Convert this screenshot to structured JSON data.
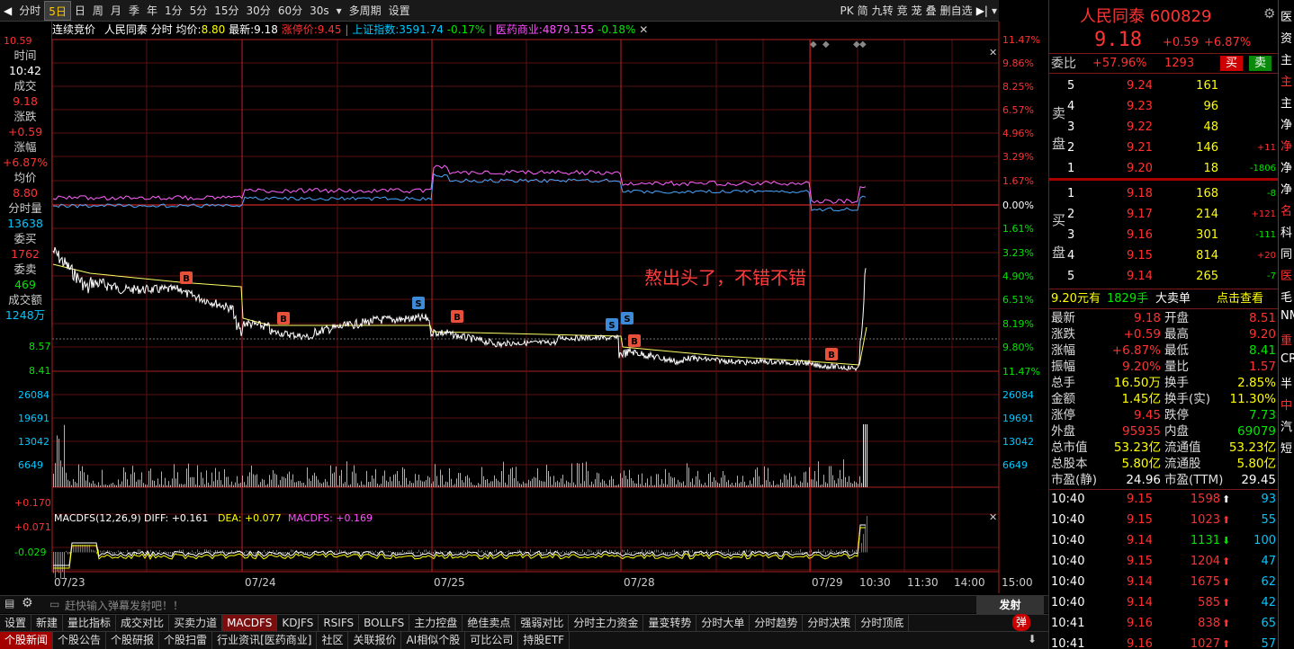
{
  "toolbar": {
    "items": [
      "分时",
      "5日",
      "日",
      "周",
      "月",
      "季",
      "年",
      "1分",
      "5分",
      "15分",
      "30分",
      "60分",
      "30s",
      "多周期",
      "设置"
    ],
    "active": 1,
    "right_items": [
      "PK",
      "简",
      "九转",
      "竞",
      "茏",
      "叠",
      "删自选"
    ]
  },
  "chart": {
    "source": "连续竞价",
    "stock_name": "人民同泰",
    "mode": "分时",
    "avg_label": "均价:",
    "avg_val": "8.80",
    "last_label": "最新:",
    "last_val": "9.18",
    "limit_label": "涨停价:",
    "limit_val": "9.45",
    "idx1": "上证指数:",
    "idx1_val": "3591.74",
    "idx1_chg": "-0.17%",
    "idx2": "医药商业:",
    "idx2_val": "4879.155",
    "idx2_chg": "-0.18%"
  },
  "price_axis": {
    "left_top": "10.59",
    "left_mid": "8.57",
    "left_bot": "8.41"
  },
  "pct_axis": {
    "upper": [
      "11.47%",
      "9.86%",
      "8.25%",
      "6.57%",
      "4.96%",
      "3.29%",
      "1.67%",
      "0.00%"
    ],
    "lower": [
      "1.61%",
      "3.23%",
      "4.90%",
      "6.51%",
      "8.19%",
      "9.80%",
      "11.47%"
    ]
  },
  "vol_axis": [
    "26084",
    "19691",
    "13042",
    "6649"
  ],
  "macd": {
    "title": "MACDFS(12,26,9)",
    "diff": "DIFF: +0.161",
    "dea": "DEA: +0.077",
    "macdfs": "MACDFS: +0.169",
    "axis": [
      "+0.170",
      "+0.071",
      "-0.029"
    ]
  },
  "xaxis": [
    "07/23",
    "07/24",
    "07/25",
    "07/28",
    "07/29",
    "10:30",
    "11:30",
    "14:00",
    "15:00"
  ],
  "annotation": "熬出头了，不错不错",
  "leftinfo": [
    [
      "时间",
      "10:42"
    ],
    [
      "成交",
      "9.18"
    ],
    [
      "涨跌",
      "+0.59"
    ],
    [
      "涨幅",
      "+6.87%"
    ],
    [
      "均价",
      "8.80"
    ],
    [
      "分时量",
      "13638"
    ],
    [
      "委买",
      "1762"
    ],
    [
      "委卖",
      "469"
    ],
    [
      "成交额",
      "1248万"
    ]
  ],
  "chart_data": {
    "type": "line",
    "title": "人民同泰 600829 5日分时",
    "x": [
      "07/23",
      "07/24",
      "07/25",
      "07/28",
      "07/29"
    ],
    "series": [
      {
        "name": "人民同泰",
        "values": [
          8.63,
          8.53,
          8.54,
          8.5,
          9.18
        ]
      }
    ],
    "ylim": [
      7.72,
      9.45
    ]
  },
  "quote": {
    "name": "人民同泰",
    "code": "600829",
    "price": "9.18",
    "chg": "+0.59",
    "pct": "+6.87%",
    "wb_label": "委比",
    "wb_val": "+57.96%",
    "wb_diff": "1293",
    "buy": "买",
    "sell": "卖"
  },
  "asks": [
    [
      "5",
      "9.24",
      "161",
      ""
    ],
    [
      "4",
      "9.23",
      "96",
      ""
    ],
    [
      "3",
      "9.22",
      "48",
      ""
    ],
    [
      "2",
      "9.21",
      "146",
      "+11"
    ],
    [
      "1",
      "9.20",
      "18",
      "-1806"
    ]
  ],
  "bids": [
    [
      "1",
      "9.18",
      "168",
      "-8"
    ],
    [
      "2",
      "9.17",
      "214",
      "+121"
    ],
    [
      "3",
      "9.16",
      "301",
      "-111"
    ],
    [
      "4",
      "9.15",
      "814",
      "+20"
    ],
    [
      "5",
      "9.14",
      "265",
      "-7"
    ]
  ],
  "ask_label": [
    "卖",
    "盘"
  ],
  "bid_label": [
    "买",
    "盘"
  ],
  "bigorder": {
    "text": "9.20元有",
    "vol": "1829手",
    "type": "大卖单",
    "link": "点击查看"
  },
  "stats": [
    [
      "最新",
      "9.18",
      "开盘",
      "8.51"
    ],
    [
      "涨跌",
      "+0.59",
      "最高",
      "9.20"
    ],
    [
      "涨幅",
      "+6.87%",
      "最低",
      "8.41"
    ],
    [
      "振幅",
      "9.20%",
      "量比",
      "1.57"
    ],
    [
      "总手",
      "16.50万",
      "换手",
      "2.85%"
    ],
    [
      "金额",
      "1.45亿",
      "换手(实)",
      "11.30%"
    ],
    [
      "涨停",
      "9.45",
      "跌停",
      "7.73"
    ],
    [
      "外盘",
      "95935",
      "内盘",
      "69079"
    ],
    [
      "总市值",
      "53.23亿",
      "流通值",
      "53.23亿"
    ],
    [
      "总股本",
      "5.80亿",
      "流通股",
      "5.80亿"
    ],
    [
      "市盈(静)",
      "24.96",
      "市盈(TTM)",
      "29.45"
    ]
  ],
  "ticks": [
    [
      "10:40",
      "9.15",
      "1598",
      "93"
    ],
    [
      "10:40",
      "9.15",
      "1023",
      "55"
    ],
    [
      "10:40",
      "9.14",
      "1131",
      "100"
    ],
    [
      "10:40",
      "9.15",
      "1204",
      "47"
    ],
    [
      "10:40",
      "9.14",
      "1675",
      "62"
    ],
    [
      "10:40",
      "9.14",
      "585",
      "42"
    ],
    [
      "10:41",
      "9.16",
      "838",
      "65"
    ],
    [
      "10:41",
      "9.16",
      "1027",
      "57"
    ]
  ],
  "bottom": {
    "input_placeholder": "赶快输入弹幕发射吧！！",
    "send": "发射",
    "tabs1": [
      "设置",
      "新建",
      "量比指标",
      "成交对比",
      "买卖力道",
      "MACDFS",
      "KDJFS",
      "RSIFS",
      "BOLLFS",
      "主力控盘",
      "绝佳卖点",
      "强弱对比",
      "分时主力资金",
      "量变转势",
      "分时大单",
      "分时趋势",
      "分时决策",
      "分时顶底"
    ],
    "tabs1_active": 5,
    "tabs2": [
      "个股新闻",
      "个股公告",
      "个股研报",
      "个股扫雷",
      "行业资讯[医药商业]",
      "社区",
      "关联报价",
      "AI相似个股",
      "可比公司",
      "持股ETF"
    ],
    "tabs2_active": 0,
    "danmu": "弹"
  },
  "farright": [
    "医",
    "资",
    "主",
    "主",
    "主",
    "净",
    "净",
    "净",
    "净",
    "名",
    "科",
    "同",
    "医",
    "毛",
    "NM",
    "重",
    "CR",
    "半",
    "中",
    "汽",
    "短"
  ]
}
